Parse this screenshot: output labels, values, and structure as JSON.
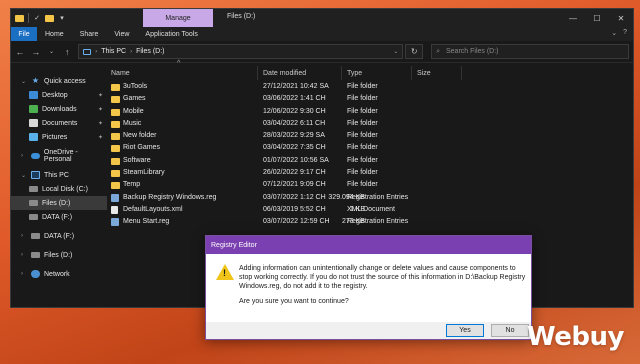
{
  "window": {
    "title": "Files (D:)",
    "manage_tab": "Manage"
  },
  "ribbon": {
    "tabs": [
      "File",
      "Home",
      "Share",
      "View",
      "Application Tools"
    ]
  },
  "address": {
    "segments": [
      "This PC",
      "Files (D:)"
    ]
  },
  "search": {
    "placeholder": "Search Files (D:)"
  },
  "sidebar": {
    "items": [
      {
        "label": "Quick access",
        "icon": "star-icon"
      },
      {
        "label": "Desktop",
        "icon": "desktop-icon",
        "pinned": true
      },
      {
        "label": "Downloads",
        "icon": "download-icon",
        "pinned": true
      },
      {
        "label": "Documents",
        "icon": "documents-icon",
        "pinned": true
      },
      {
        "label": "Pictures",
        "icon": "pictures-icon",
        "pinned": true
      },
      {
        "label": "OneDrive - Personal",
        "icon": "cloud-icon"
      },
      {
        "label": "This PC",
        "icon": "computer-icon"
      },
      {
        "label": "Local Disk (C:)",
        "icon": "drive-icon"
      },
      {
        "label": "Files (D:)",
        "icon": "drive-icon",
        "selected": true
      },
      {
        "label": "DATA (F:)",
        "icon": "drive-icon"
      },
      {
        "label": "DATA (F:)",
        "icon": "drive-icon"
      },
      {
        "label": "Files (D:)",
        "icon": "drive-icon"
      },
      {
        "label": "Network",
        "icon": "network-icon"
      }
    ]
  },
  "columns": {
    "name": "Name",
    "date": "Date modified",
    "type": "Type",
    "size": "Size"
  },
  "files": [
    {
      "name": "3uTools",
      "date": "27/12/2021 10:42 SA",
      "type": "File folder",
      "size": "",
      "kind": "folder"
    },
    {
      "name": "Games",
      "date": "03/06/2022 1:41 CH",
      "type": "File folder",
      "size": "",
      "kind": "folder"
    },
    {
      "name": "Mobile",
      "date": "12/06/2022 9:30 CH",
      "type": "File folder",
      "size": "",
      "kind": "folder"
    },
    {
      "name": "Music",
      "date": "03/04/2022 6:11 CH",
      "type": "File folder",
      "size": "",
      "kind": "folder"
    },
    {
      "name": "New folder",
      "date": "28/03/2022 9:29 SA",
      "type": "File folder",
      "size": "",
      "kind": "folder"
    },
    {
      "name": "Riot Games",
      "date": "03/04/2022 7:35 CH",
      "type": "File folder",
      "size": "",
      "kind": "folder"
    },
    {
      "name": "Software",
      "date": "01/07/2022 10:56 SA",
      "type": "File folder",
      "size": "",
      "kind": "folder"
    },
    {
      "name": "SteamLibrary",
      "date": "26/02/2022 9:17 CH",
      "type": "File folder",
      "size": "",
      "kind": "folder"
    },
    {
      "name": "Temp",
      "date": "07/12/2021 9:09 CH",
      "type": "File folder",
      "size": "",
      "kind": "folder"
    },
    {
      "name": "Backup Registry Windows.reg",
      "date": "03/07/2022 1:12 CH",
      "type": "Registration Entries",
      "size": "329.094 KB",
      "kind": "reg"
    },
    {
      "name": "DefaultLayouts.xml",
      "date": "06/03/2019 5:52 CH",
      "type": "XML Document",
      "size": "1 KB",
      "kind": "xml"
    },
    {
      "name": "Menu Start.reg",
      "date": "03/07/2022 12:59 CH",
      "type": "Registration Entries",
      "size": "273 KB",
      "kind": "reg"
    }
  ],
  "dialog": {
    "title": "Registry Editor",
    "message": "Adding information can unintentionally change or delete values and cause components to stop working correctly. If you do not trust the source of this information in D:\\Backup Registry Windows.reg, do not add it to the registry.",
    "question": "Are you sure you want to continue?",
    "yes": "Yes",
    "no": "No"
  },
  "watermark": "Webuy"
}
